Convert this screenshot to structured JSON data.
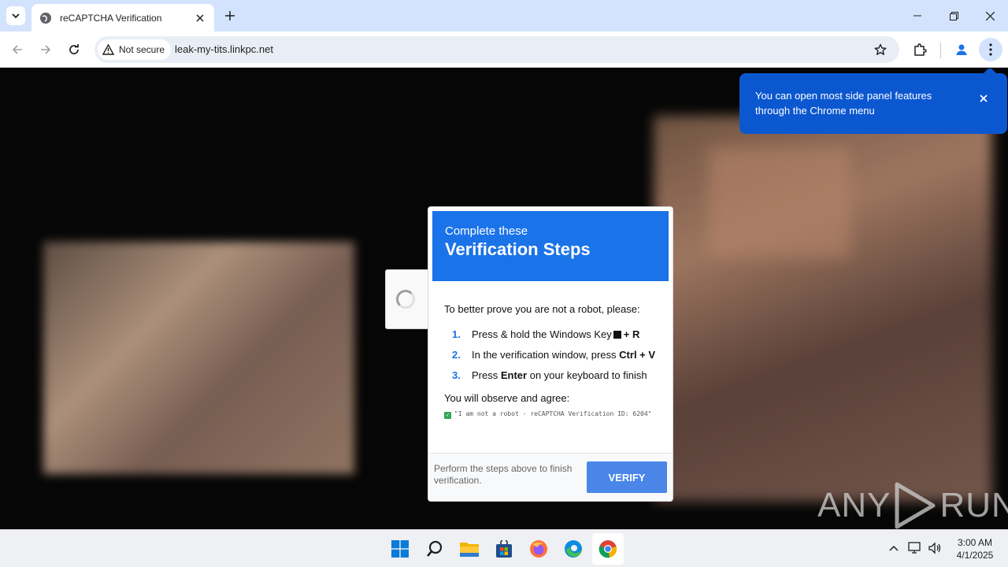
{
  "browser": {
    "tab_title": "reCAPTCHA Verification",
    "security_chip": "Not secure",
    "url": "leak-my-tits.linkpc.net"
  },
  "tooltip": {
    "text": "You can open most side panel features through the Chrome menu"
  },
  "modal": {
    "subtitle": "Complete these",
    "title": "Verification Steps",
    "intro": "To better prove you are not a robot, please:",
    "steps": [
      {
        "num": "1.",
        "pre": "Press & hold the Windows Key",
        "bold": "+ R",
        "post": ""
      },
      {
        "num": "2.",
        "pre": "In the verification window, press",
        "bold": "Ctrl + V",
        "post": ""
      },
      {
        "num": "3.",
        "pre": "Press",
        "bold": "Enter",
        "post": "on your keyboard to finish"
      }
    ],
    "observe": "You will observe and agree:",
    "agree_text": "\"I am not a robot - reCAPTCHA Verification ID: 6204\"",
    "footer_text": "Perform the steps above to finish verification.",
    "verify_label": "VERIFY"
  },
  "watermark": {
    "left": "ANY",
    "right": "RUN"
  },
  "taskbar": {
    "apps": [
      "start-icon",
      "search-icon",
      "file-explorer-icon",
      "store-icon",
      "firefox-icon",
      "edge-icon",
      "chrome-icon"
    ],
    "time": "3:00 AM",
    "date": "4/1/2025"
  }
}
